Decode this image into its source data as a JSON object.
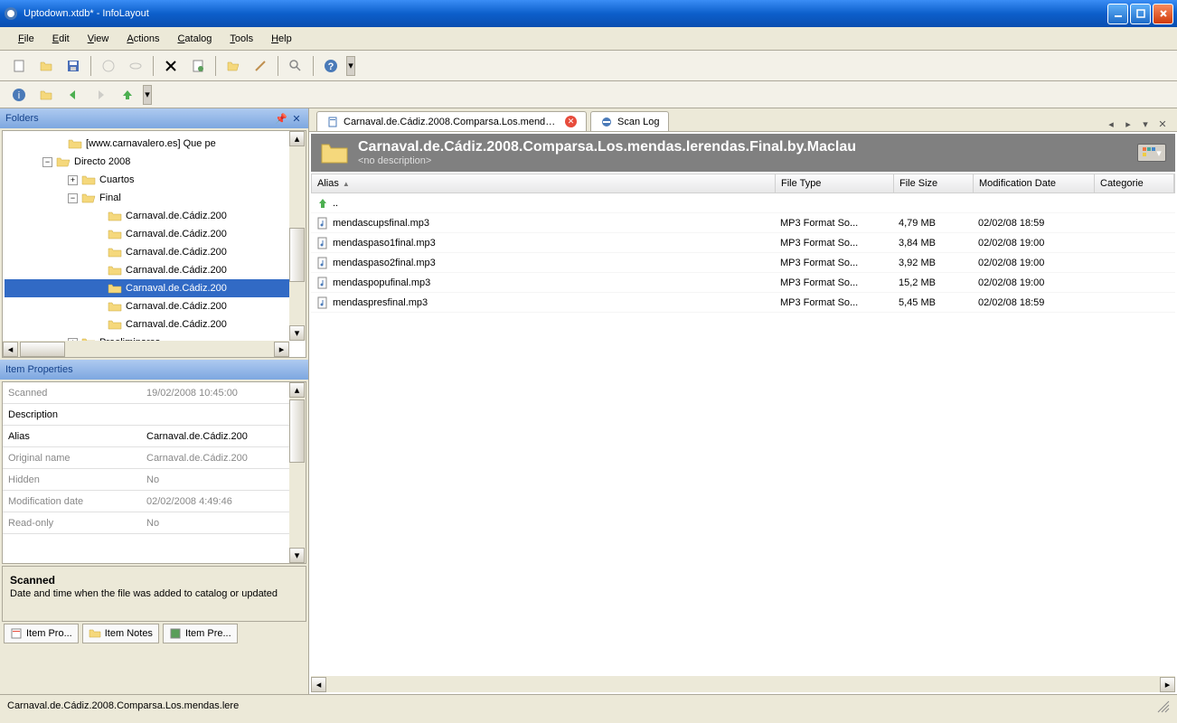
{
  "window": {
    "title": "Uptodown.xtdb* - InfoLayout"
  },
  "menu": {
    "file": "File",
    "edit": "Edit",
    "view": "View",
    "actions": "Actions",
    "catalog": "Catalog",
    "tools": "Tools",
    "help": "Help"
  },
  "panels": {
    "folders": "Folders",
    "item_properties": "Item Properties"
  },
  "tree": {
    "n0": "[www.carnavalero.es] Que pe",
    "n1": "Directo 2008",
    "n2": "Cuartos",
    "n3": "Final",
    "n4": "Carnaval.de.Cádiz.200",
    "n5": "Carnaval.de.Cádiz.200",
    "n6": "Carnaval.de.Cádiz.200",
    "n7": "Carnaval.de.Cádiz.200",
    "n8": "Carnaval.de.Cádiz.200",
    "n9": "Carnaval.de.Cádiz.200",
    "n10": "Carnaval.de.Cádiz.200",
    "n11": "Preeliminares"
  },
  "props": {
    "r0": {
      "label": "Scanned",
      "value": "19/02/2008 10:45:00"
    },
    "r1": {
      "label": "Description",
      "value": ""
    },
    "r2": {
      "label": "Alias",
      "value": "Carnaval.de.Cádiz.200"
    },
    "r3": {
      "label": "Original name",
      "value": "Carnaval.de.Cádiz.200"
    },
    "r4": {
      "label": "Hidden",
      "value": "No"
    },
    "r5": {
      "label": "Modification date",
      "value": "02/02/2008 4:49:46"
    },
    "r6": {
      "label": "Read-only",
      "value": "No"
    }
  },
  "prop_desc": {
    "title": "Scanned",
    "text": "Date and time when the file was added to catalog or updated"
  },
  "bottom_tabs": {
    "t0": "Item Pro...",
    "t1": "Item Notes",
    "t2": "Item Pre..."
  },
  "tabs": {
    "t0": "Carnaval.de.Cádiz.2008.Comparsa.Los.mendas.lerendas.Final.by.Maclau",
    "t1": "Scan Log"
  },
  "content_header": {
    "title": "Carnaval.de.Cádiz.2008.Comparsa.Los.mendas.lerendas.Final.by.Maclau",
    "subtitle": "<no description>"
  },
  "columns": {
    "alias": "Alias",
    "type": "File Type",
    "size": "File Size",
    "date": "Modification Date",
    "cat": "Categorie"
  },
  "files": {
    "up": "..",
    "r0": {
      "alias": "mendascupsfinal.mp3",
      "type": "MP3 Format So...",
      "size": "4,79 MB",
      "date": "02/02/08 18:59"
    },
    "r1": {
      "alias": "mendaspaso1final.mp3",
      "type": "MP3 Format So...",
      "size": "3,84 MB",
      "date": "02/02/08 19:00"
    },
    "r2": {
      "alias": "mendaspaso2final.mp3",
      "type": "MP3 Format So...",
      "size": "3,92 MB",
      "date": "02/02/08 19:00"
    },
    "r3": {
      "alias": "mendaspopufinal.mp3",
      "type": "MP3 Format So...",
      "size": "15,2 MB",
      "date": "02/02/08 19:00"
    },
    "r4": {
      "alias": "mendaspresfinal.mp3",
      "type": "MP3 Format So...",
      "size": "5,45 MB",
      "date": "02/02/08 18:59"
    }
  },
  "statusbar": {
    "text": "Carnaval.de.Cádiz.2008.Comparsa.Los.mendas.lere"
  }
}
